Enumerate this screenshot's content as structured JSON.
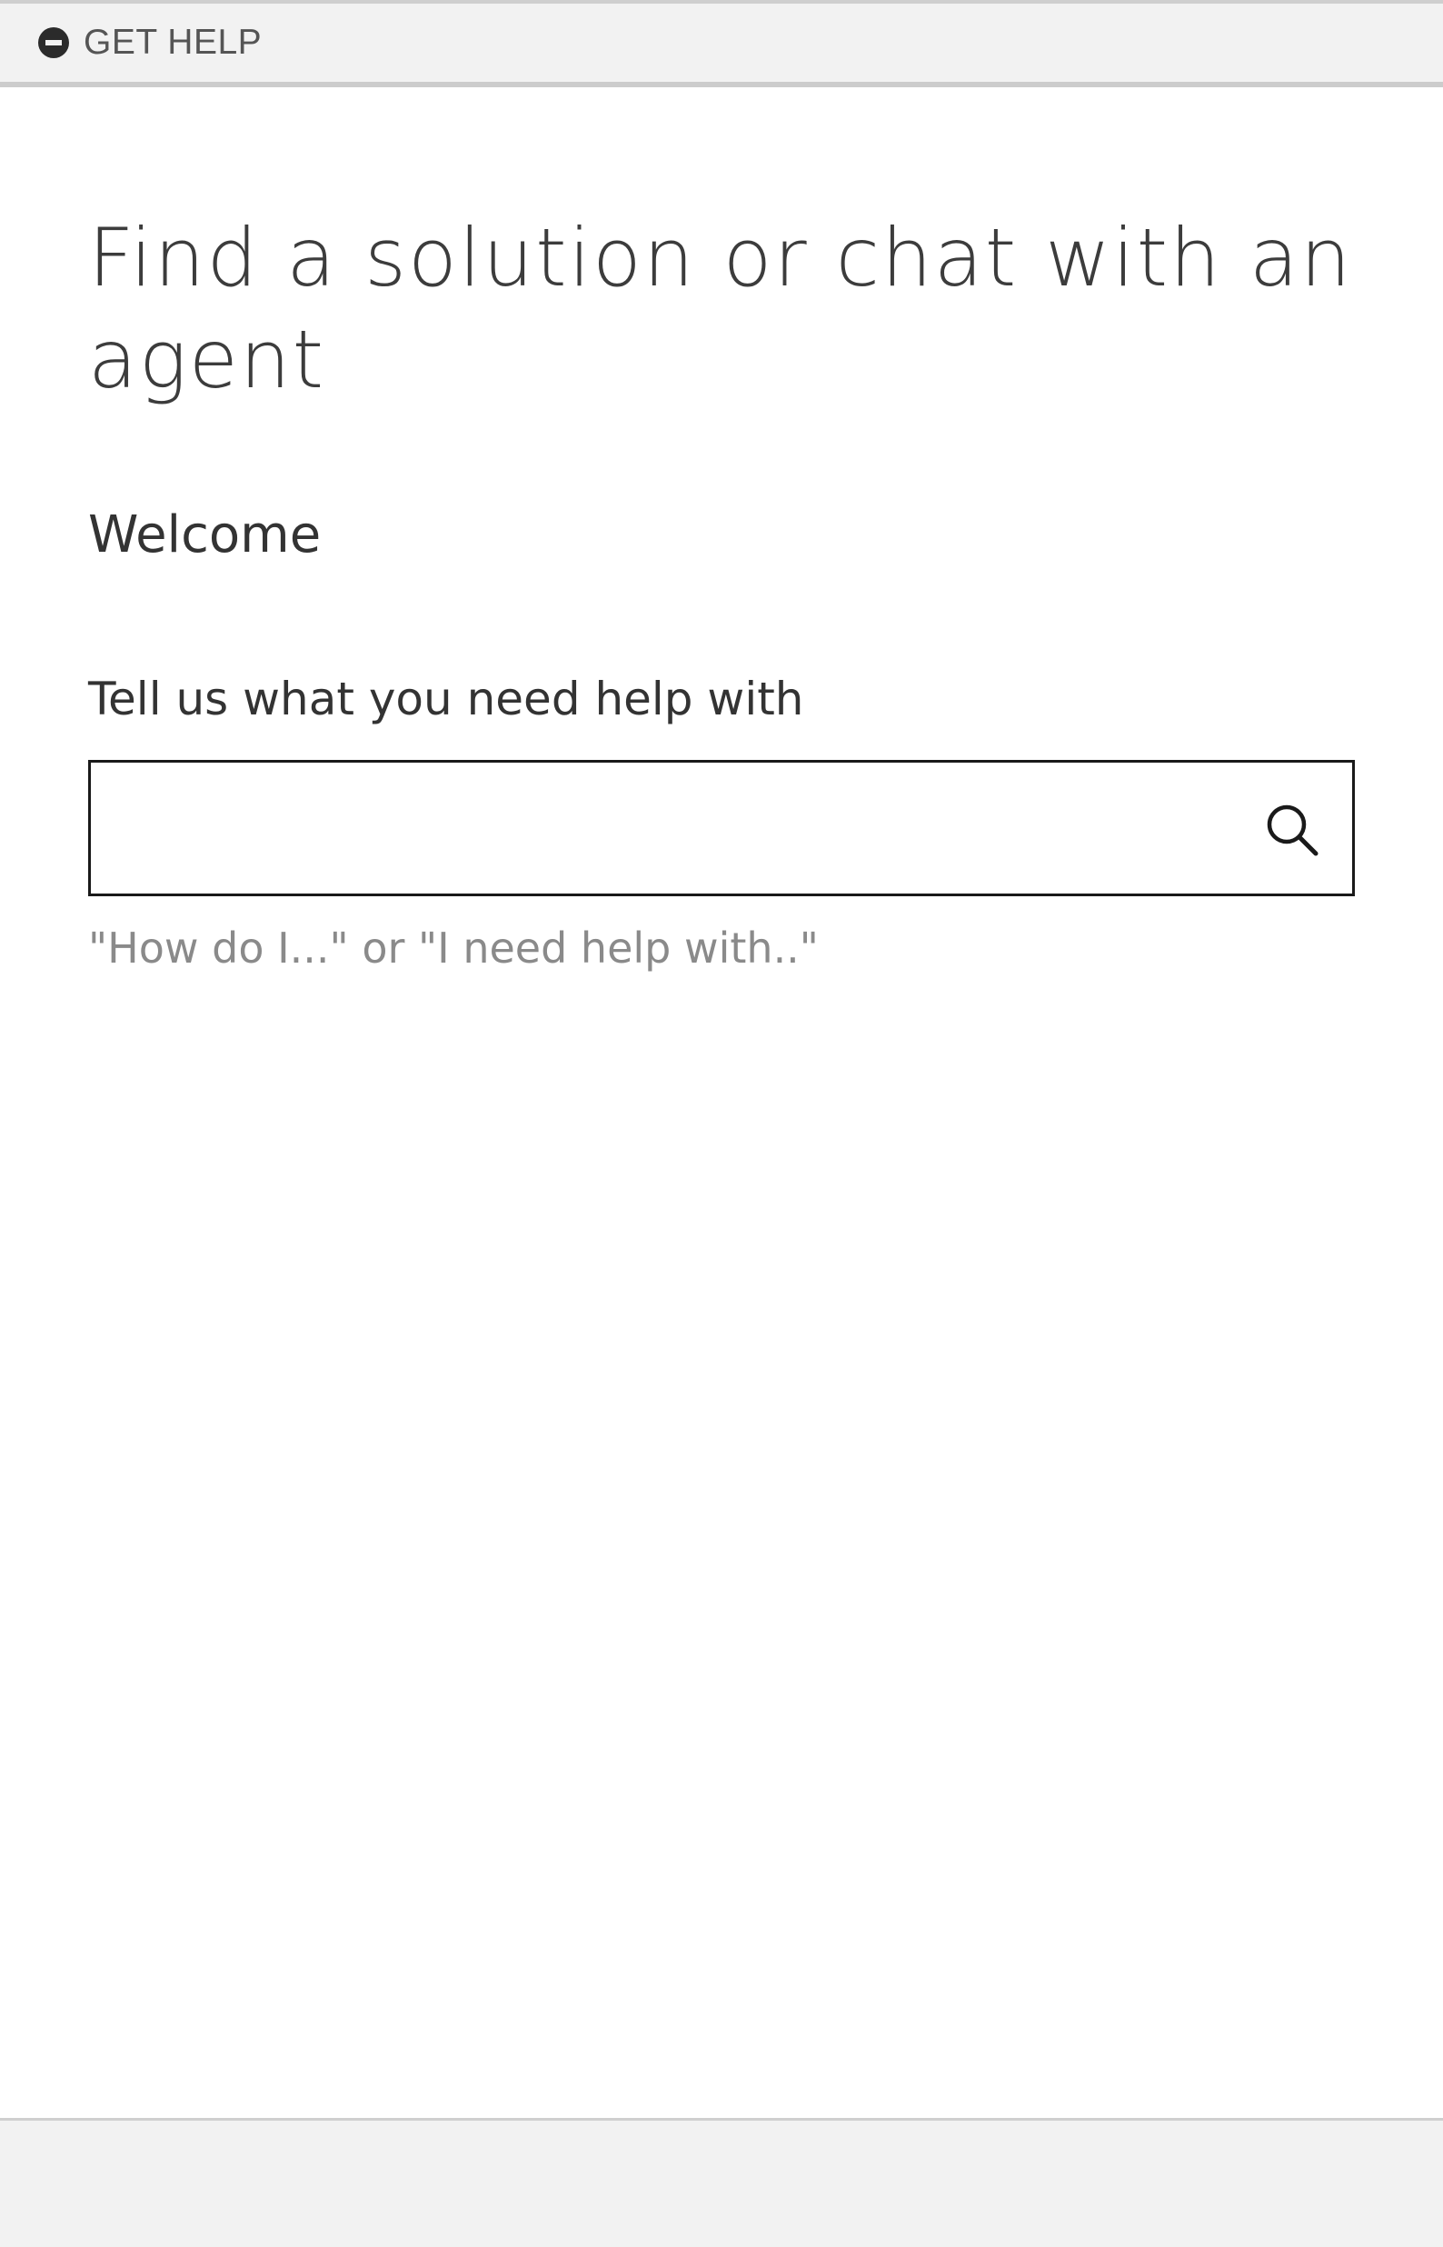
{
  "header": {
    "toggle_label": "GET HELP",
    "toggle_icon": "minus-circle-icon"
  },
  "main": {
    "title": "Find a solution or chat with an agent",
    "welcome": "Welcome",
    "search": {
      "label": "Tell us what you need help with",
      "value": "",
      "hint": "\"How do I...\" or \"I need help with..\"",
      "icon": "search-icon"
    }
  },
  "colors": {
    "bar_background": "#f2f2f2",
    "text": "#333333",
    "hint_text": "#8a8a8a",
    "input_border": "#1a1a1a"
  }
}
